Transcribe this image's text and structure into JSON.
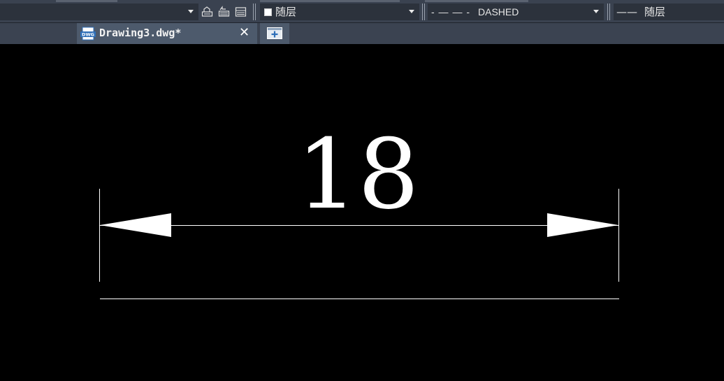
{
  "toolbar": {
    "layer_combo": {
      "value": ""
    },
    "color_combo": {
      "value": "随层"
    },
    "linetype_combo": {
      "value": "DASHED",
      "pattern": "- — — -"
    },
    "lineweight_combo": {
      "value": "随层",
      "sample": "——"
    }
  },
  "tabs": [
    {
      "label": "Drawing3.dwg*",
      "icon": "dwg-file-icon",
      "close_glyph": "✕"
    }
  ],
  "canvas": {
    "dimension_text": "18",
    "colors": {
      "background": "#000000",
      "geometry": "#ffffff"
    }
  }
}
